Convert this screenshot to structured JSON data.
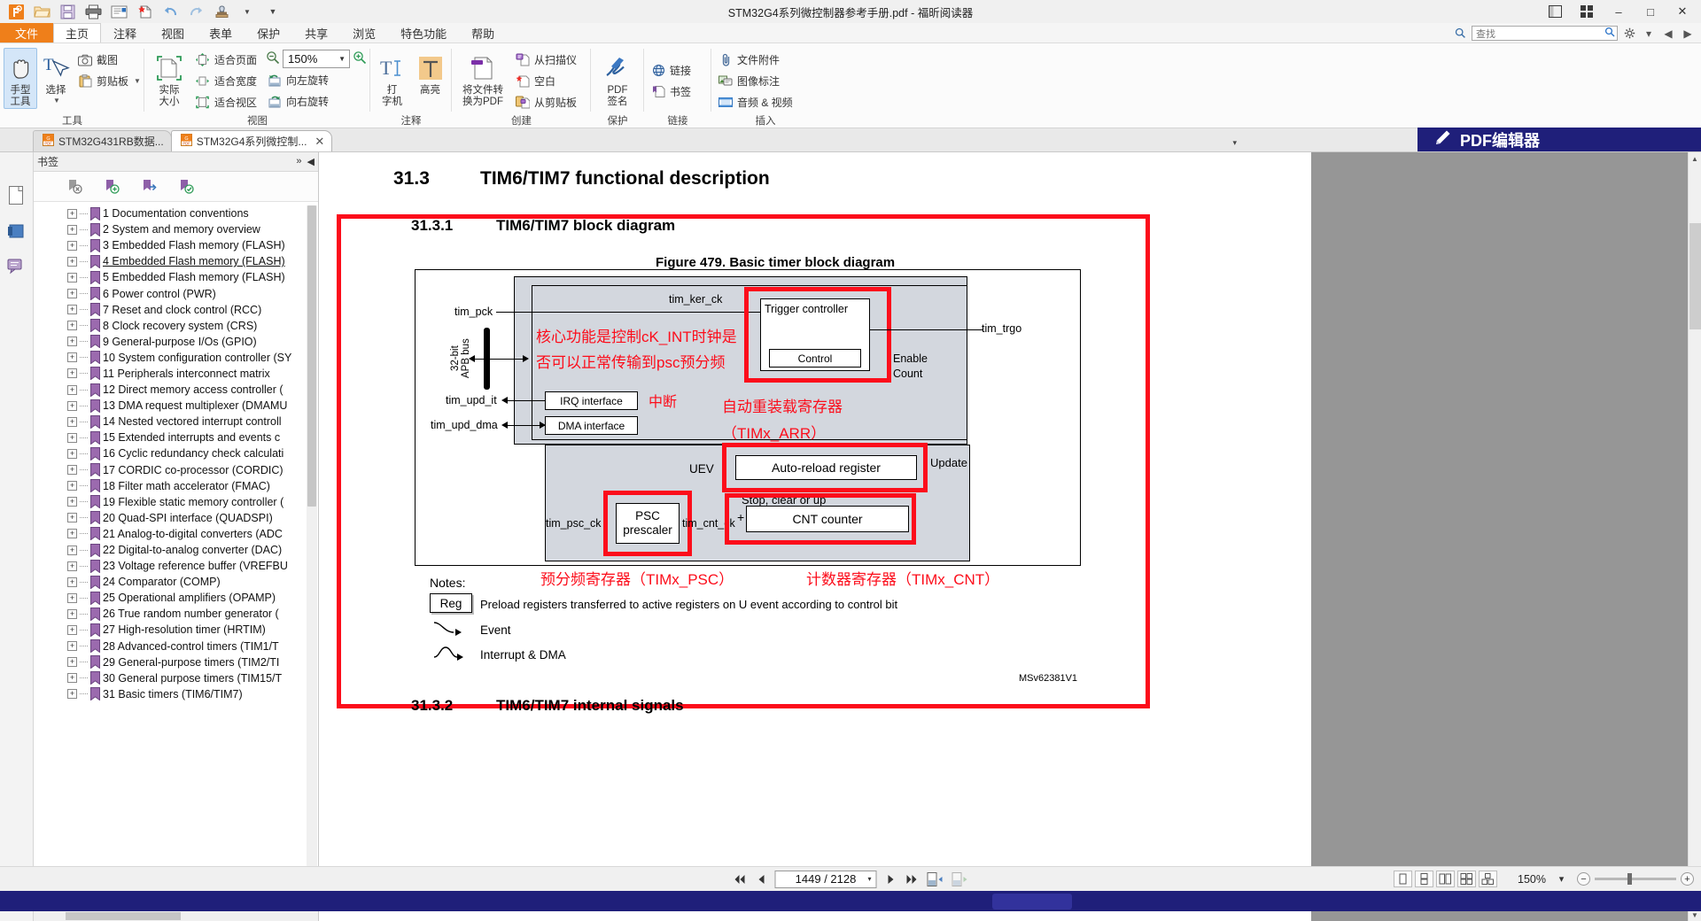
{
  "window": {
    "title": "STM32G4系列微控制器参考手册.pdf - 福昕阅读器",
    "minimize": "–",
    "maximize": "□",
    "close": "✕",
    "restore_icon": "❐",
    "grid_icon": "▦"
  },
  "quick_access": [
    {
      "name": "foxit-logo-icon",
      "glyph": "G"
    },
    {
      "name": "open-icon",
      "glyph": "📂"
    },
    {
      "name": "save-icon",
      "glyph": "💾"
    },
    {
      "name": "print-icon",
      "glyph": "🖨"
    },
    {
      "name": "email-icon",
      "glyph": "✉"
    },
    {
      "name": "new-doc-icon",
      "glyph": "✳"
    },
    {
      "name": "undo-icon",
      "glyph": "↺"
    },
    {
      "name": "redo-icon",
      "glyph": "↻"
    },
    {
      "name": "stamp-icon",
      "glyph": "♗"
    },
    {
      "name": "qat-caret-icon",
      "glyph": "▾"
    },
    {
      "name": "qat-more-icon",
      "glyph": "⋮"
    }
  ],
  "menu": {
    "tabs": [
      {
        "label": "文件",
        "type": "file"
      },
      {
        "label": "主页",
        "type": "active"
      },
      {
        "label": "注释",
        "type": "normal"
      },
      {
        "label": "视图",
        "type": "normal"
      },
      {
        "label": "表单",
        "type": "normal"
      },
      {
        "label": "保护",
        "type": "normal"
      },
      {
        "label": "共享",
        "type": "normal"
      },
      {
        "label": "浏览",
        "type": "normal"
      },
      {
        "label": "特色功能",
        "type": "normal"
      },
      {
        "label": "帮助",
        "type": "normal"
      }
    ],
    "search_placeholder": "查找",
    "settings_label": "⚙",
    "nav_prev": "◀",
    "nav_next": "▶"
  },
  "ribbon": {
    "groups": [
      {
        "title": "工具",
        "big": [
          {
            "label": "手型\n工具",
            "name": "hand-tool-button",
            "selected": true
          },
          {
            "label": "选择",
            "name": "select-tool-button",
            "selected": false,
            "dropdown": true
          }
        ],
        "small": [
          {
            "label": "截图",
            "name": "snapshot-button"
          },
          {
            "label": "剪贴板",
            "name": "clipboard-button",
            "dropdown": true
          }
        ]
      },
      {
        "title": "视图",
        "big": [
          {
            "label": "实际\n大小",
            "name": "actual-size-button",
            "selected": false
          }
        ],
        "small": [
          {
            "label": "适合页面",
            "name": "fit-page-button"
          },
          {
            "label": "适合宽度",
            "name": "fit-width-button"
          },
          {
            "label": "适合视区",
            "name": "fit-visible-button"
          }
        ],
        "small2": [
          {
            "label": "向左旋转",
            "name": "rotate-left-button"
          },
          {
            "label": "向右旋转",
            "name": "rotate-right-button"
          }
        ],
        "zoom_value": "150%",
        "zoom_out_icon": "zoom-out-icon",
        "zoom_in_icon": "zoom-in-icon"
      },
      {
        "title": "注释",
        "big": [
          {
            "label": "打\n字机",
            "name": "typewriter-button",
            "selected": false
          },
          {
            "label": "高亮",
            "name": "highlight-button",
            "selected": false
          }
        ]
      },
      {
        "title": "创建",
        "big": [
          {
            "label": "将文件转\n换为PDF",
            "name": "convert-to-pdf-button",
            "selected": false
          }
        ],
        "small": [
          {
            "label": "从扫描仪",
            "name": "from-scanner-button"
          },
          {
            "label": "空白",
            "name": "blank-page-button"
          },
          {
            "label": "从剪贴板",
            "name": "from-clipboard-button"
          }
        ]
      },
      {
        "title": "保护",
        "big": [
          {
            "label": "PDF\n签名",
            "name": "pdf-sign-button",
            "selected": false
          }
        ]
      },
      {
        "title": "链接",
        "small": [
          {
            "label": "链接",
            "name": "link-button"
          },
          {
            "label": "书签",
            "name": "bookmark-button"
          }
        ]
      },
      {
        "title": "插入",
        "small": [
          {
            "label": "文件附件",
            "name": "file-attachment-button"
          },
          {
            "label": "图像标注",
            "name": "image-annotation-button"
          },
          {
            "label": "音频 & 视频",
            "name": "audio-video-button"
          }
        ]
      }
    ]
  },
  "doc_tabs": {
    "items": [
      {
        "label": "STM32G431RB数据...",
        "active": false
      },
      {
        "label": "STM32G4系列微控制...",
        "active": true
      }
    ],
    "close_glyph": "✕",
    "overflow_caret": "▾",
    "editor_banner": "PDF编辑器",
    "editor_banner_icon": "✎"
  },
  "left_rail": [
    {
      "name": "page-thumbnails-icon"
    },
    {
      "name": "layers-icon"
    },
    {
      "name": "comments-icon"
    }
  ],
  "bookmarks": {
    "panel_title": "书签",
    "collapse_glyph": "»",
    "hide_glyph": "◀",
    "toolbar": [
      {
        "name": "delete-bookmark-icon"
      },
      {
        "name": "add-bookmark-icon"
      },
      {
        "name": "goto-bookmark-icon"
      },
      {
        "name": "bookmark-options-icon"
      }
    ],
    "items": [
      {
        "label": "1 Documentation conventions",
        "underline": false
      },
      {
        "label": "2 System and memory overview",
        "underline": false
      },
      {
        "label": "3 Embedded Flash memory (FLASH)",
        "underline": false
      },
      {
        "label": "4 Embedded Flash memory (FLASH)",
        "underline": true
      },
      {
        "label": "5 Embedded Flash memory (FLASH)",
        "underline": false
      },
      {
        "label": "6 Power control (PWR)",
        "underline": false
      },
      {
        "label": "7 Reset and clock control (RCC)",
        "underline": false
      },
      {
        "label": "8 Clock recovery system (CRS)",
        "underline": false
      },
      {
        "label": "9 General-purpose I/Os (GPIO)",
        "underline": false
      },
      {
        "label": "10 System configuration controller (SY",
        "underline": false
      },
      {
        "label": "11 Peripherals interconnect matrix",
        "underline": false
      },
      {
        "label": "12 Direct memory access controller (",
        "underline": false
      },
      {
        "label": "13 DMA request multiplexer (DMAMU",
        "underline": false
      },
      {
        "label": "14 Nested vectored interrupt controll",
        "underline": false
      },
      {
        "label": "15 Extended interrupts and events c",
        "underline": false
      },
      {
        "label": "16 Cyclic redundancy check calculati",
        "underline": false
      },
      {
        "label": "17 CORDIC co-processor (CORDIC)",
        "underline": false
      },
      {
        "label": "18 Filter math accelerator (FMAC)",
        "underline": false
      },
      {
        "label": "19 Flexible static memory controller (",
        "underline": false
      },
      {
        "label": "20 Quad-SPI interface (QUADSPI)",
        "underline": false
      },
      {
        "label": "21 Analog-to-digital converters (ADC",
        "underline": false
      },
      {
        "label": "22 Digital-to-analog converter (DAC)",
        "underline": false
      },
      {
        "label": "23 Voltage reference buffer (VREFBU",
        "underline": false
      },
      {
        "label": "24 Comparator (COMP)",
        "underline": false
      },
      {
        "label": "25 Operational amplifiers (OPAMP)",
        "underline": false
      },
      {
        "label": "26 True random number generator (",
        "underline": false
      },
      {
        "label": "27 High-resolution timer (HRTIM)",
        "underline": false
      },
      {
        "label": "28 Advanced-control timers (TIM1/T",
        "underline": false
      },
      {
        "label": "29 General-purpose timers (TIM2/TI",
        "underline": false
      },
      {
        "label": "30 General purpose timers (TIM15/T",
        "underline": false
      },
      {
        "label": "31 Basic timers (TIM6/TIM7)",
        "underline": false
      }
    ]
  },
  "document": {
    "section_number": "31.3",
    "section_title": "TIM6/TIM7 functional description",
    "subsection_number": "31.3.1",
    "subsection_title": "TIM6/TIM7 block diagram",
    "figure_title": "Figure 479. Basic timer block diagram",
    "next_section_number": "31.3.2",
    "next_section_title": "TIM6/TIM7 internal signals",
    "figure_id": "MSv62381V1",
    "signals": {
      "tim_pck": "tim_pck",
      "tim_ker_ck": "tim_ker_ck",
      "apb_bus": "32-bit\nAPB bus",
      "tim_upd_it": "tim_upd_it",
      "tim_upd_dma": "tim_upd_dma",
      "tim_trgo": "tim_trgo",
      "tim_psc_ck": "tim_psc_ck",
      "tim_cnt_ck": "tim_cnt_ck",
      "uev": "UEV",
      "update": "Update",
      "enable": "Enable",
      "count": "Count",
      "stop_clear_up": "Stop, clear or up",
      "plus": "+"
    },
    "blocks": {
      "trigger_controller": "Trigger controller",
      "control": "Control",
      "irq_interface": "IRQ interface",
      "dma_interface": "DMA interface",
      "auto_reload": "Auto-reload register",
      "psc_prescaler": "PSC\nprescaler",
      "cnt_counter": "CNT counter"
    },
    "notes": {
      "label": "Notes:",
      "reg_box": "Reg",
      "reg_text": "Preload registers transferred to active registers on U event according to control bit",
      "event": "Event",
      "interrupt_dma": "Interrupt & DMA"
    },
    "annotations": {
      "core_func_line1": "核心功能是控制cK_INT时钟是",
      "core_func_line2": "否可以正常传输到psc预分频",
      "interrupt": "中断",
      "arr_line1": "自动重装载寄存器",
      "arr_line2": "（TIMx_ARR）",
      "psc_note": "预分频寄存器（TIMx_PSC）",
      "cnt_note": "计数器寄存器（TIMx_CNT）"
    }
  },
  "status": {
    "first_page_icon": "⏮",
    "prev_page_icon": "◀",
    "page_value": "1449 / 2128",
    "page_caret": "▾",
    "next_page_icon": "▶",
    "last_page_icon": "⏭",
    "page_layout_icon": "page-fit-icon",
    "page_layout_icon2": "page-split-icon",
    "view_modes": [
      {
        "name": "single-page-view",
        "on": false
      },
      {
        "name": "continuous-view",
        "on": false
      },
      {
        "name": "facing-view",
        "on": false
      },
      {
        "name": "facing-continuous-view",
        "on": false
      },
      {
        "name": "separate-cover-view",
        "on": false
      }
    ],
    "zoom_level": "150%",
    "zoom_caret": "▾",
    "zoom_out": "−",
    "zoom_in": "+"
  }
}
